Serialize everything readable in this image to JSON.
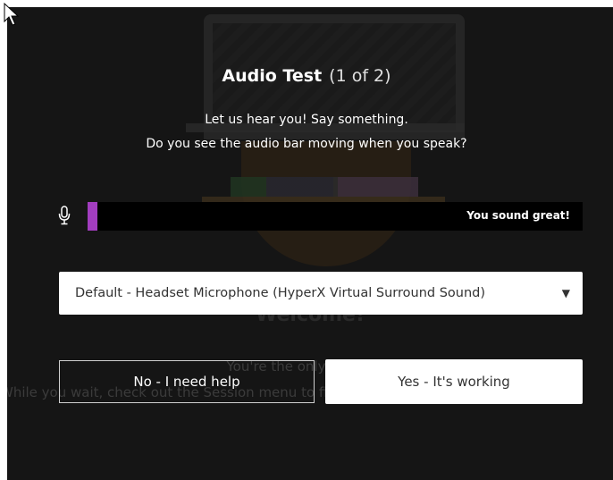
{
  "dialog": {
    "title": "Audio Test",
    "step": "(1 of 2)",
    "prompt_line1": "Let us hear you! Say something.",
    "prompt_line2": "Do you see the audio bar moving when you speak?"
  },
  "meter": {
    "icon": "microphone-icon",
    "level": 0.02,
    "status_text": "You sound great!",
    "fill_color": "#a23dbf"
  },
  "device_select": {
    "selected": "Default - Headset Microphone (HyperX Virtual Surround Sound)",
    "icon": "chevron-down-icon"
  },
  "buttons": {
    "no_label": "No - I need help",
    "yes_label": "Yes - It's working"
  },
  "background": {
    "welcome": "Welcome!",
    "alone": "You're the only one here.",
    "wait": "While you wait, check out the Session menu to find ways to collaborate"
  }
}
